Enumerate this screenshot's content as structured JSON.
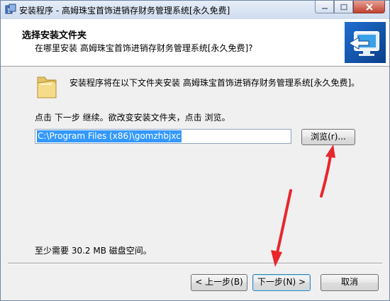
{
  "window": {
    "title": "安装程序 - 高姆珠宝首饰进销存财务管理系统[永久免费]",
    "icon": "installer-icon"
  },
  "header": {
    "title": "选择安装文件夹",
    "subtitle": "在哪里安装 高姆珠宝首饰进销存财务管理系统[永久免费]?"
  },
  "body": {
    "info": "安装程序将在以下文件夹安装 高姆珠宝首饰进销存财务管理系统[永久免费]。",
    "hint": "点击 下一步 继续。欲改变安装文件夹，点击 浏览。",
    "install_path": "C:\\Program Files (x86)\\gomzhbjxc",
    "browse_label": "浏览(r)...",
    "space_required": "至少需要 30.2 MB 磁盘空间。"
  },
  "buttons": {
    "back": "< 上一步(B)",
    "next": "下一步(N) >",
    "cancel": "取消"
  },
  "colors": {
    "annotation_arrow": "#e8262b",
    "selection": "#3399ff"
  }
}
